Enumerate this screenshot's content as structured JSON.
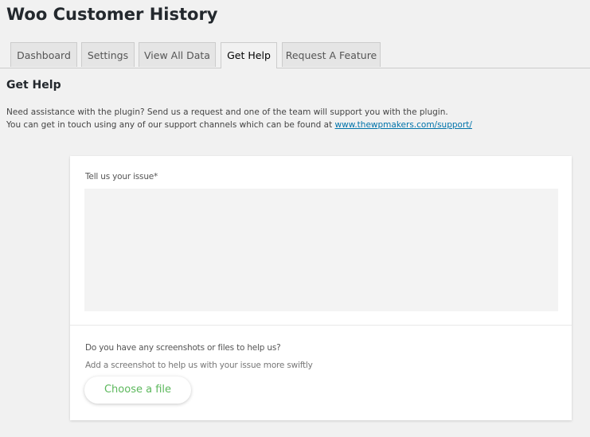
{
  "page": {
    "title": "Woo Customer History"
  },
  "tabs": [
    {
      "label": "Dashboard"
    },
    {
      "label": "Settings"
    },
    {
      "label": "View All Data"
    },
    {
      "label": "Get Help"
    },
    {
      "label": "Request A Feature"
    }
  ],
  "active_tab": "Get Help",
  "help": {
    "heading": "Get Help",
    "line1": "Need assistance with the plugin? Send us a request and one of the team will support you with the plugin.",
    "line2_prefix": "You can get in touch using any of our support channels which can be found at ",
    "support_link": "www.thewpmakers.com/support/"
  },
  "form": {
    "issue_label": "Tell us your issue*",
    "issue_value": "",
    "files_label": "Do you have any screenshots or files to help us?",
    "files_hint": "Add a screenshot to help us with your issue more swiftly",
    "choose_file_label": "Choose a file"
  },
  "colors": {
    "link": "#0073aa",
    "choose_file_text": "#5cb85c",
    "background": "#f1f1f1"
  }
}
